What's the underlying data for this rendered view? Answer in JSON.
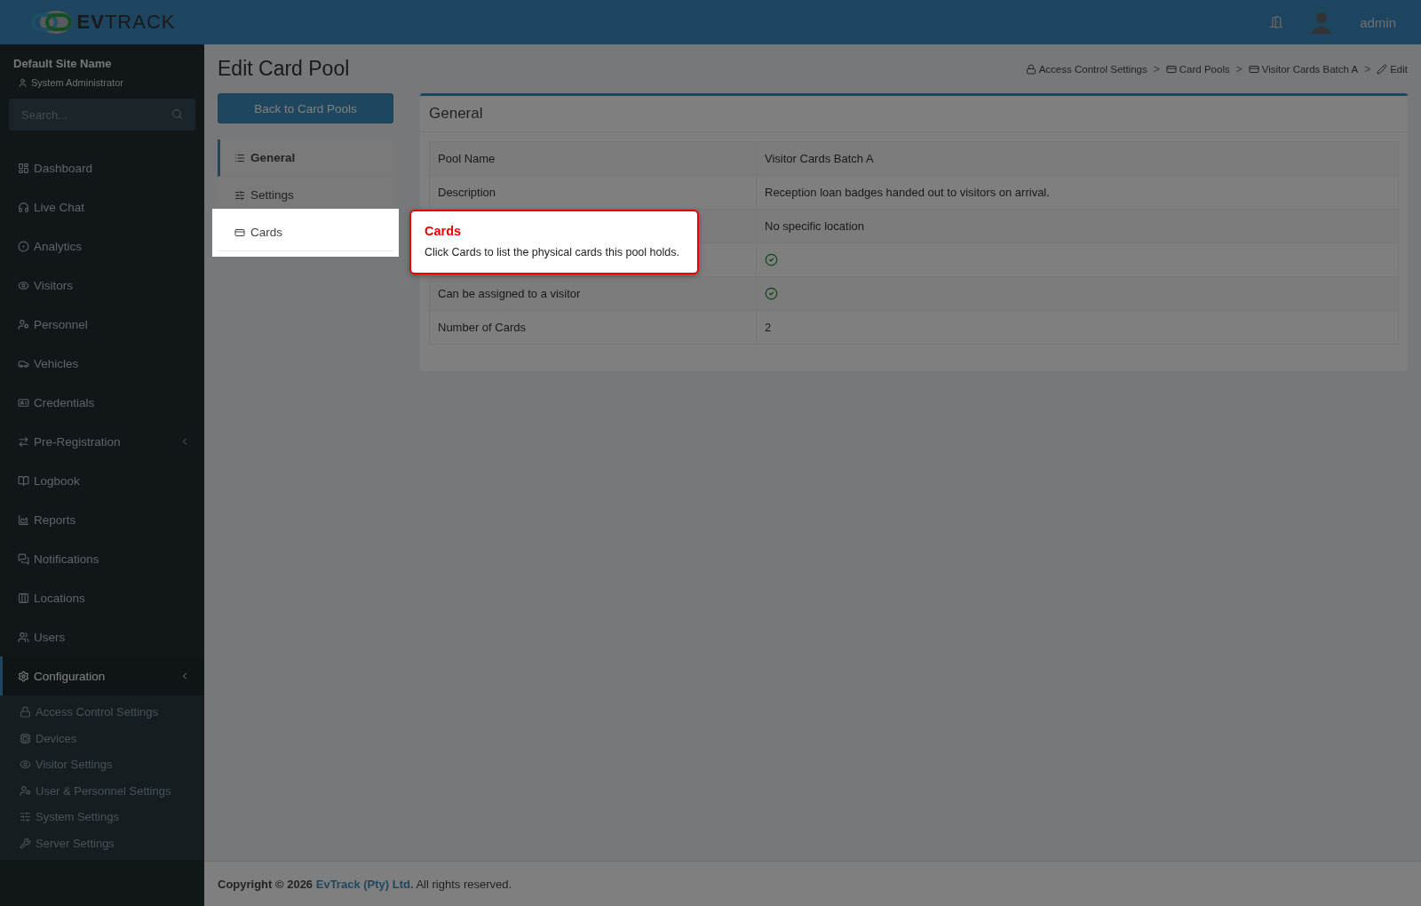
{
  "brand": "**EV**TRACK",
  "topbar": {
    "user": "admin"
  },
  "sidebar": {
    "site": "Default Site Name",
    "role": "System Administrator",
    "search": {
      "placeholder": "Search..."
    },
    "items": [
      {
        "label": "Dashboard",
        "selected": false
      },
      {
        "label": "Live Chat",
        "selected": false
      },
      {
        "label": "Analytics",
        "selected": false
      },
      {
        "label": "Visitors",
        "selected": false
      },
      {
        "label": "Personnel",
        "selected": false
      },
      {
        "label": "Vehicles",
        "selected": false
      },
      {
        "label": "Credentials",
        "selected": false
      },
      {
        "label": "Pre-Registration",
        "selected": false,
        "has_submenu": true
      },
      {
        "label": "Logbook",
        "selected": false
      },
      {
        "label": "Reports",
        "selected": false
      },
      {
        "label": "Notifications",
        "selected": false
      },
      {
        "label": "Locations",
        "selected": false
      },
      {
        "label": "Users",
        "selected": false
      },
      {
        "label": "Configuration",
        "selected": true,
        "has_submenu": true,
        "children": [
          {
            "label": "Access Control Settings"
          },
          {
            "label": "Devices"
          },
          {
            "label": "Visitor Settings"
          },
          {
            "label": "User & Personnel Settings"
          },
          {
            "label": "System Settings"
          },
          {
            "label": "Server Settings"
          }
        ]
      }
    ]
  },
  "page": {
    "title": "Edit Card Pool",
    "back_button": "Back to Card Pools",
    "breadcrumb_separator": ">",
    "breadcrumbs": [
      {
        "label": "Access Control Settings"
      },
      {
        "label": "Card Pools"
      },
      {
        "label": "Visitor Cards Batch A"
      },
      {
        "label": "Edit"
      }
    ],
    "tabs": [
      {
        "label": "General",
        "selected": true,
        "highlighted": false
      },
      {
        "label": "Settings",
        "selected": false,
        "highlighted": false
      },
      {
        "label": "Cards",
        "selected": false,
        "highlighted": true
      }
    ],
    "panel": {
      "title": "General",
      "rows": [
        {
          "kind": "text",
          "label": "Pool Name",
          "value": "Visitor Cards Batch A"
        },
        {
          "kind": "text",
          "label": "Description",
          "value": "Reception loan badges handed out to visitors on arrival."
        },
        {
          "kind": "text",
          "value": "No specific location"
        },
        {
          "kind": "check"
        },
        {
          "kind": "check",
          "label": "Can be assigned to a visitor"
        },
        {
          "kind": "text",
          "label": "Number of Cards",
          "value": "2"
        }
      ]
    }
  },
  "tour": {
    "title": "Cards",
    "text": "Click Cards to list the physical cards this pool holds."
  },
  "footer": {
    "prefix": "Copyright © 2026",
    "link": "EvTrack (Pty) Ltd.",
    "suffix": "All rights reserved."
  }
}
